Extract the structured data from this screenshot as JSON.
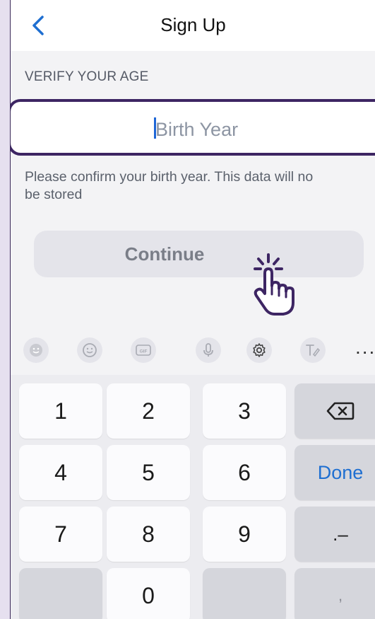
{
  "header": {
    "title": "Sign Up",
    "back_icon": "chevron-left-icon"
  },
  "form": {
    "section_label": "VERIFY YOUR AGE",
    "birth_year": {
      "value": "",
      "placeholder": "Birth Year"
    },
    "helper_text": "Please confirm your birth year. This data will no\nbe stored",
    "continue_label": "Continue"
  },
  "toolbar": {
    "icons": [
      "emoji-icon",
      "sticker-icon",
      "gif-icon",
      "microphone-icon",
      "settings-icon",
      "handwriting-icon"
    ],
    "more_label": "..."
  },
  "keypad": {
    "rows": [
      [
        "1",
        "2",
        "3",
        "backspace"
      ],
      [
        "4",
        "5",
        "6",
        "Done"
      ],
      [
        "7",
        "8",
        "9",
        ".–"
      ],
      [
        "",
        "0",
        "",
        ","
      ]
    ]
  },
  "colors": {
    "accent": "#3d2563",
    "link_blue": "#1f6fd1",
    "caret": "#1e66d6"
  }
}
